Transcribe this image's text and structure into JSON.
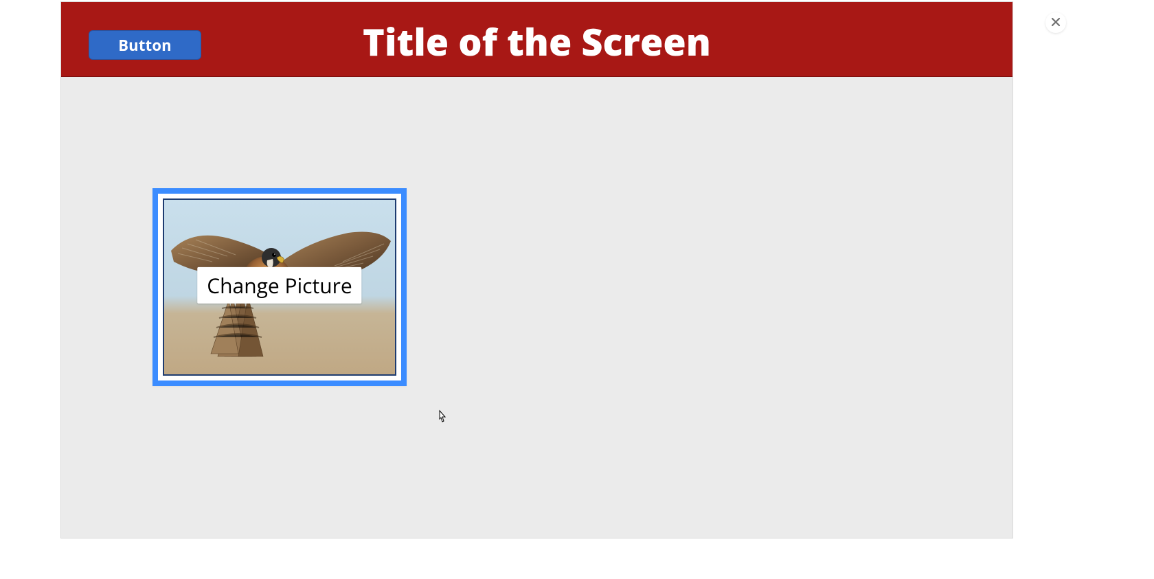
{
  "header": {
    "title": "Title of the Screen",
    "button_label": "Button"
  },
  "picture_tile": {
    "overlay_label": "Change Picture",
    "image_desc": "falcon-flying"
  },
  "close_icon": "close-icon",
  "cursor_icon": "pointer-cursor-icon",
  "colors": {
    "header_bg": "#a81815",
    "button_bg": "#2f6ac7",
    "panel_bg": "#ebebeb",
    "selection_border": "#3b8cff"
  }
}
